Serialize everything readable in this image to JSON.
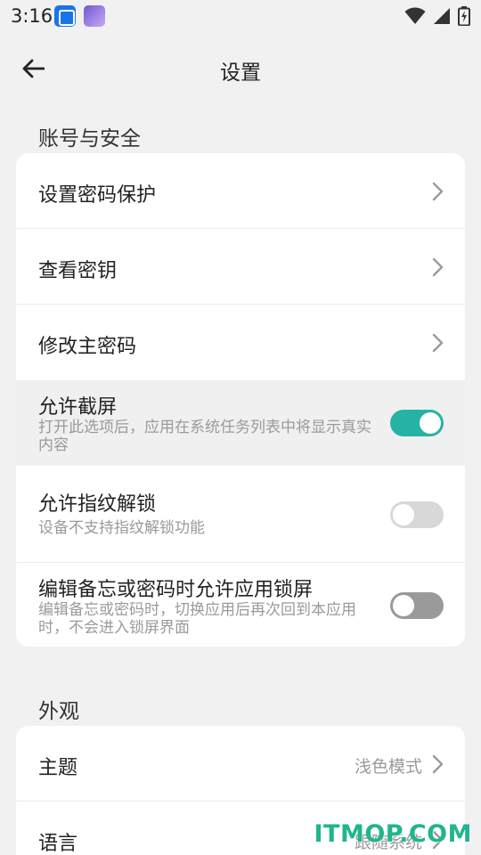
{
  "status_bar": {
    "time": "3:16",
    "notification_icons": [
      "translate-app-icon",
      "avatar-app-icon"
    ],
    "system_icons": [
      "wifi-icon",
      "signal-icon",
      "battery-charging-icon"
    ]
  },
  "app_bar": {
    "back_icon": "arrow-left-icon",
    "title": "设置"
  },
  "sections": {
    "account": {
      "header": "账号与安全",
      "rows": [
        {
          "title": "设置密码保护"
        },
        {
          "title": "查看密钥"
        },
        {
          "title": "修改主密码"
        },
        {
          "title": "允许截屏",
          "subtitle": "打开此选项后，应用在系统任务列表中将显示真实内容",
          "toggle": true
        },
        {
          "title": "允许指纹解锁",
          "subtitle": "设备不支持指纹解锁功能",
          "toggle": false
        },
        {
          "title": "编辑备忘或密码时允许应用锁屏",
          "subtitle": "编辑备忘或密码时，切换应用后再次回到本应用时，不会进入锁屏界面",
          "toggle": false
        }
      ]
    },
    "appearance": {
      "header": "外观",
      "rows": [
        {
          "title": "主题",
          "value": "浅色模式"
        },
        {
          "title": "语言",
          "value": "跟随系统"
        }
      ]
    }
  },
  "colors": {
    "accent": "#26b3a6",
    "background": "#f1f1f1",
    "card": "#ffffff"
  },
  "watermark": "ITMOP.COM"
}
